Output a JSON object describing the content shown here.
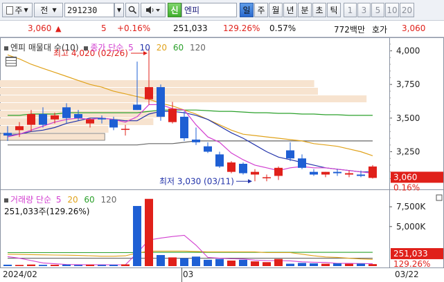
{
  "toolbar": {
    "market_label": "주",
    "jeon_label": "전",
    "code": "291230",
    "etf_badge": "신",
    "name": "엔피",
    "periods": [
      {
        "label": "일",
        "selected": true
      },
      {
        "label": "주",
        "selected": false
      },
      {
        "label": "월",
        "selected": false
      },
      {
        "label": "년",
        "selected": false
      },
      {
        "label": "분",
        "selected": false
      },
      {
        "label": "초",
        "selected": false
      },
      {
        "label": "틱",
        "selected": false
      }
    ],
    "numbers": [
      "1",
      "3",
      "5",
      "10",
      "20"
    ],
    "icons": [
      "search-icon",
      "dropdown-icon",
      "speaker-icon"
    ]
  },
  "infobar": {
    "price": "3,060",
    "change": "5",
    "change_pct": "+0.16%",
    "volume": "251,033",
    "vol_ratio": "129.26%",
    "turnover": "0.57%",
    "amount": "772백만",
    "ask_label": "호가",
    "ask_price": "3,060"
  },
  "price_panel": {
    "legend_title": "엔피 매물대 수(10)",
    "legend_ma_label": "종가 단순",
    "ma_periods": [
      "5",
      "10",
      "20",
      "60",
      "120"
    ],
    "max_annotation": "최고 4,020 (02/26)",
    "min_annotation": "최저 3,030 (03/11)",
    "y_ticks": [
      "4,000",
      "3,750",
      "3,500",
      "3,250"
    ],
    "last_price_tag": "3,060",
    "last_pct_tag": "0.16%"
  },
  "volume_panel": {
    "legend_title": "거래량 단순",
    "ma_periods": [
      "5",
      "20",
      "60",
      "120"
    ],
    "current_text": "251,033주(129.26%)",
    "y_ticks": [
      "7,500K",
      "5,000K"
    ],
    "last_vol_tag": "251,033",
    "last_pct_tag": "129.26%"
  },
  "x_axis": {
    "labels": [
      "2024/02",
      "03",
      "03/22"
    ]
  },
  "colors": {
    "up": "#e0201a",
    "down": "#1e5fd4",
    "ma5": "#d23fd0",
    "ma10": "#2233aa",
    "ma20": "#e0a21a",
    "ma60": "#2aa02a",
    "ma120": "#666666",
    "volume_profile": "#f7e3cf"
  },
  "chart_data": {
    "type": "candlestick",
    "yunit": "KRW",
    "ylim": [
      2980,
      4080
    ],
    "candles": [
      {
        "o": 3390,
        "h": 3440,
        "l": 3330,
        "c": 3370
      },
      {
        "o": 3410,
        "h": 3470,
        "l": 3360,
        "c": 3440
      },
      {
        "o": 3450,
        "h": 3560,
        "l": 3400,
        "c": 3530
      },
      {
        "o": 3530,
        "h": 3580,
        "l": 3430,
        "c": 3450
      },
      {
        "o": 3490,
        "h": 3540,
        "l": 3460,
        "c": 3520
      },
      {
        "o": 3580,
        "h": 3610,
        "l": 3460,
        "c": 3500
      },
      {
        "o": 3530,
        "h": 3560,
        "l": 3480,
        "c": 3500
      },
      {
        "o": 3460,
        "h": 3500,
        "l": 3430,
        "c": 3490
      },
      {
        "o": 3500,
        "h": 3520,
        "l": 3460,
        "c": 3490
      },
      {
        "o": 3490,
        "h": 3510,
        "l": 3410,
        "c": 3430
      },
      {
        "o": 3420,
        "h": 3450,
        "l": 3370,
        "c": 3420
      },
      {
        "o": 3600,
        "h": 3920,
        "l": 3560,
        "c": 3560
      },
      {
        "o": 3640,
        "h": 4020,
        "l": 3600,
        "c": 3730
      },
      {
        "o": 3730,
        "h": 3750,
        "l": 3480,
        "c": 3510
      },
      {
        "o": 3470,
        "h": 3620,
        "l": 3460,
        "c": 3570
      },
      {
        "o": 3510,
        "h": 3550,
        "l": 3330,
        "c": 3350
      },
      {
        "o": 3340,
        "h": 3430,
        "l": 3300,
        "c": 3320
      },
      {
        "o": 3290,
        "h": 3320,
        "l": 3240,
        "c": 3250
      },
      {
        "o": 3230,
        "h": 3250,
        "l": 3130,
        "c": 3140
      },
      {
        "o": 3100,
        "h": 3180,
        "l": 3090,
        "c": 3170
      },
      {
        "o": 3160,
        "h": 3170,
        "l": 3080,
        "c": 3090
      },
      {
        "o": 3080,
        "h": 3120,
        "l": 3030,
        "c": 3100
      },
      {
        "o": 3060,
        "h": 3080,
        "l": 3030,
        "c": 3060
      },
      {
        "o": 3070,
        "h": 3140,
        "l": 3040,
        "c": 3130
      },
      {
        "o": 3260,
        "h": 3320,
        "l": 3180,
        "c": 3200
      },
      {
        "o": 3200,
        "h": 3230,
        "l": 3120,
        "c": 3130
      },
      {
        "o": 3100,
        "h": 3120,
        "l": 3070,
        "c": 3080
      },
      {
        "o": 3080,
        "h": 3100,
        "l": 3060,
        "c": 3100
      },
      {
        "o": 3100,
        "h": 3120,
        "l": 3070,
        "c": 3090
      },
      {
        "o": 3080,
        "h": 3110,
        "l": 3060,
        "c": 3090
      },
      {
        "o": 3080,
        "h": 3110,
        "l": 3060,
        "c": 3070
      },
      {
        "o": 3055,
        "h": 3150,
        "l": 3050,
        "c": 3140
      }
    ],
    "ma": {
      "ma5": [
        3360,
        3380,
        3410,
        3440,
        3470,
        3490,
        3500,
        3490,
        3500,
        3490,
        3470,
        3510,
        3600,
        3600,
        3570,
        3560,
        3450,
        3360,
        3320,
        3240,
        3190,
        3150,
        3130,
        3110,
        3130,
        3140,
        3130,
        3130,
        3120,
        3110,
        3100,
        3090
      ],
      "ma10": [
        3370,
        3380,
        3400,
        3410,
        3430,
        3460,
        3480,
        3500,
        3500,
        3490,
        3480,
        3480,
        3530,
        3550,
        3550,
        3540,
        3520,
        3490,
        3440,
        3390,
        3350,
        3300,
        3250,
        3210,
        3190,
        3170,
        3150,
        3130,
        3120,
        3110,
        3100,
        3100
      ],
      "ma20": [
        3970,
        3940,
        3900,
        3870,
        3840,
        3810,
        3780,
        3750,
        3730,
        3700,
        3680,
        3660,
        3640,
        3610,
        3590,
        3560,
        3530,
        3490,
        3450,
        3410,
        3380,
        3370,
        3360,
        3350,
        3340,
        3330,
        3310,
        3300,
        3290,
        3270,
        3250,
        3220
      ],
      "ma60": [
        3520,
        3520,
        3530,
        3530,
        3530,
        3540,
        3540,
        3540,
        3540,
        3540,
        3540,
        3540,
        3550,
        3560,
        3560,
        3560,
        3560,
        3555,
        3550,
        3550,
        3545,
        3540,
        3540,
        3535,
        3535,
        3530,
        3530,
        3525,
        3525,
        3520,
        3520,
        3520
      ],
      "ma120": [
        3300,
        3300,
        3300,
        3300,
        3300,
        3300,
        3300,
        3300,
        3300,
        3300,
        3300,
        3300,
        3310,
        3310,
        3310,
        3320,
        3330,
        3330,
        3330,
        3330,
        3330,
        3330,
        3330,
        3330,
        3330,
        3330,
        3330,
        3330,
        3330,
        3330,
        3330,
        3330
      ]
    },
    "volume_profile_ratio": [
      0.84,
      0.85,
      0.98,
      0.36,
      0.44,
      0.41,
      0.29,
      0.28
    ],
    "volume": {
      "ylim": [
        0,
        9000
      ],
      "values": [
        180,
        150,
        200,
        160,
        170,
        190,
        140,
        180,
        150,
        170,
        220,
        7600,
        8500,
        1400,
        1100,
        1000,
        1200,
        800,
        900,
        700,
        800,
        600,
        500,
        900,
        300,
        400,
        350,
        300,
        350,
        300,
        320,
        251
      ],
      "ma5": [
        1200,
        1000,
        700,
        400,
        300,
        200,
        180,
        170,
        170,
        160,
        170,
        1660,
        3300,
        3550,
        3740,
        3900,
        2640,
        1100,
        1000,
        920,
        900,
        760,
        700,
        700,
        660,
        540,
        490,
        460,
        340,
        340,
        320,
        300
      ],
      "ma20": [
        1500,
        1480,
        1450,
        1420,
        1400,
        1380,
        1350,
        1300,
        1250,
        1250,
        1300,
        1650,
        1900,
        1900,
        1900,
        1900,
        1850,
        1800,
        1800,
        1800,
        1800,
        1800,
        1700,
        1700,
        1700,
        1500,
        1300,
        1150,
        1100,
        1000,
        900,
        850
      ],
      "ma60": [
        1700,
        1700,
        1700,
        1700,
        1700,
        1700,
        1700,
        1700,
        1700,
        1700,
        1700,
        1720,
        1740,
        1740,
        1740,
        1740,
        1740,
        1740,
        1740,
        1740,
        1740,
        1740,
        1740,
        1740,
        1740,
        1740,
        1740,
        1740,
        1740,
        1740,
        1740,
        1740
      ],
      "ma120": [
        1000,
        1000,
        1000,
        1000,
        1000,
        1000,
        1000,
        1000,
        1000,
        1000,
        1000,
        1000,
        1000,
        1000,
        1000,
        1000,
        1000,
        1000,
        1000,
        1000,
        1000,
        1000,
        1000,
        1000,
        1000,
        1000,
        1000,
        1000,
        1000,
        1000,
        1000,
        1000
      ]
    }
  }
}
